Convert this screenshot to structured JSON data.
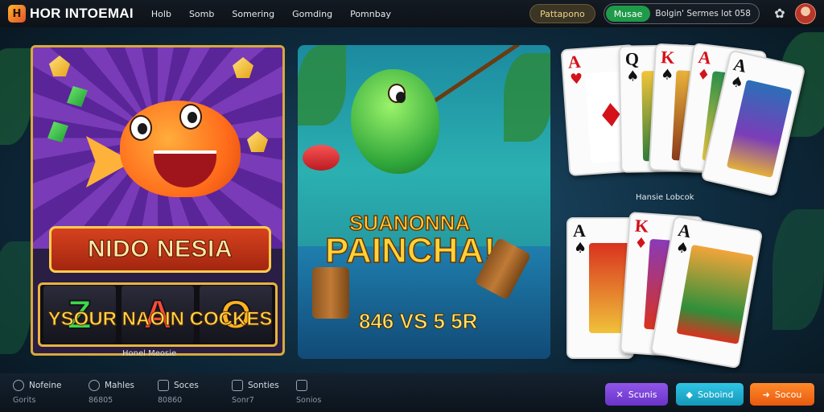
{
  "header": {
    "logo_mark": "⬛",
    "logo_text": "HOR INTOEMAI",
    "nav": [
      "Holb",
      "Somb",
      "Somering",
      "Gomding",
      "Pomnbay"
    ],
    "pill_left": "Pattapono",
    "pill_green": "Musae",
    "combo_text": "Bolgin' Sermes lot 058"
  },
  "panels": {
    "left": {
      "banner": "NIDO NESIA",
      "reels": [
        "Z",
        "A",
        "O"
      ],
      "caption": "YSOUR NAOIN COCKES",
      "under_label": "Honel Meosie"
    },
    "middle": {
      "title_top": "SUANONNA",
      "title_main": "PAINCHA!",
      "score": "846 VS 5 5R"
    },
    "cards_top": {
      "ranks": [
        "A",
        "Q",
        "K",
        "A",
        "A"
      ],
      "label": "Hansie Lobcok"
    },
    "cards_bottom": {
      "ranks": [
        "A",
        "K",
        "A"
      ]
    }
  },
  "bottom": {
    "items": [
      {
        "main": "Nofeine",
        "sub": "Gorits",
        "icon": "circle-icon"
      },
      {
        "main": "Mahles",
        "sub": "86805",
        "icon": "clock-icon"
      },
      {
        "main": "Soces",
        "sub": "80860",
        "icon": "chat-icon"
      },
      {
        "main": "Sonties",
        "sub": "Sonr7",
        "icon": "monitor-icon"
      },
      {
        "main": "",
        "sub": "Sonios",
        "icon": "bag-icon"
      }
    ],
    "buttons": {
      "purple": "Scunis",
      "teal": "Soboind",
      "orange": "Socou"
    }
  },
  "colors": {
    "accent_gold": "#d9a93c",
    "btn_purple": "#7a3fdb",
    "btn_teal": "#1fb1d4",
    "btn_orange": "#f3711b",
    "pill_green": "#1f9a49"
  }
}
